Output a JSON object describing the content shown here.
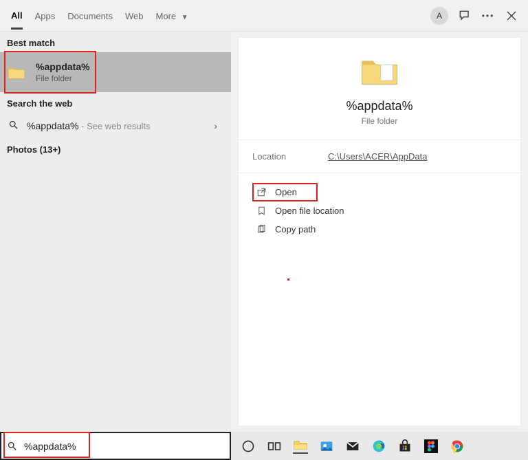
{
  "tabs": {
    "all": "All",
    "apps": "Apps",
    "documents": "Documents",
    "web": "Web",
    "more": "More"
  },
  "topActions": {
    "avatar": "A"
  },
  "left": {
    "bestMatchLabel": "Best match",
    "bestMatch": {
      "title": "%appdata%",
      "subtitle": "File folder"
    },
    "searchWebLabel": "Search the web",
    "webResult": {
      "query": "%appdata%",
      "hint": " - See web results"
    },
    "photosLabel": "Photos (13+)"
  },
  "preview": {
    "title": "%appdata%",
    "subtitle": "File folder",
    "locationLabel": "Location",
    "locationValue": "C:\\Users\\ACER\\AppData",
    "actions": {
      "open": "Open",
      "openLoc": "Open file location",
      "copyPath": "Copy path"
    }
  },
  "search": {
    "value": "%appdata%"
  }
}
